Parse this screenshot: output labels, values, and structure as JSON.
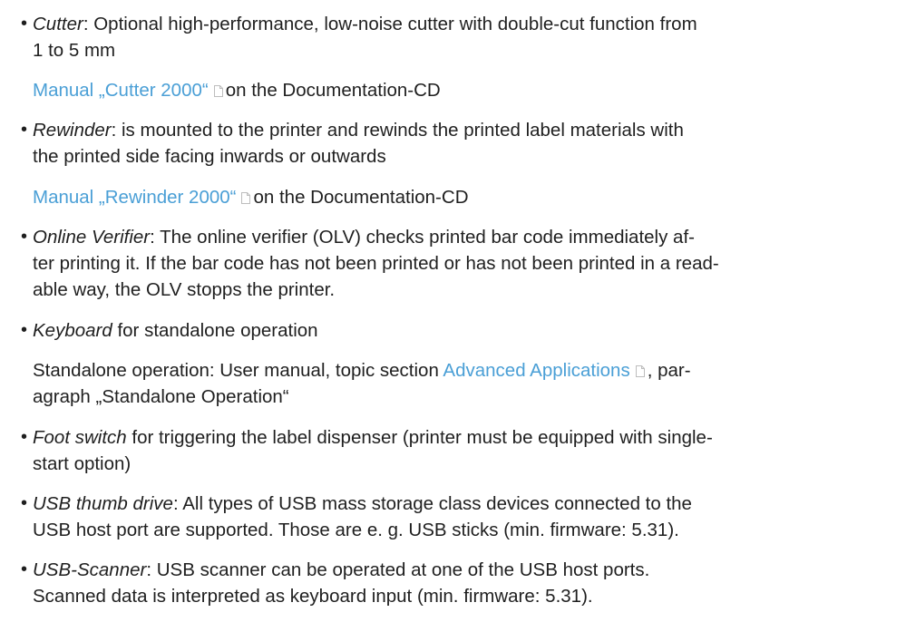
{
  "items": [
    {
      "term": "Cutter",
      "text_line1": ": Optional high-performance, low-noise cutter with double-cut function from",
      "text_line2": "1 to 5 mm",
      "sub_link": "Manual „Cutter 2000“",
      "sub_text": "on the Documentation-CD"
    },
    {
      "term": "Rewinder",
      "text_line1": ": is mounted to the printer and rewinds the printed label materials with",
      "text_line2": "the printed side facing inwards or outwards",
      "sub_link": "Manual „Rewinder 2000“",
      "sub_text": "on the Documentation-CD"
    },
    {
      "term": "Online Verifier",
      "text_line1": ": The online verifier (OLV) checks printed bar code immediately af-",
      "text_line2": "ter printing it. If the bar code has not been printed or has not been printed in a read-",
      "text_line3": "able way, the OLV stopps the printer."
    },
    {
      "term": "Keyboard",
      "text_line1": " for standalone operation",
      "sub_prefix": "Standalone operation: User manual, topic section ",
      "sub_link": "Advanced Applications",
      "sub_suffix": ", par-",
      "sub_line2": "agraph „Standalone Operation“"
    },
    {
      "term": "Foot switch",
      "text_line1": " for triggering the label dispenser (printer must be equipped with single-",
      "text_line2": "start option)"
    },
    {
      "term": "USB thumb drive",
      "text_line1": ": All types of USB mass storage class devices connected to the",
      "text_line2": "USB host port are supported. Those are e. g. USB sticks (min. firmware: 5.31)."
    },
    {
      "term": "USB-Scanner",
      "text_line1": ": USB scanner can be operated at one of the USB host ports.",
      "text_line2": "Scanned data is interpreted as keyboard input (min. firmware: 5.31)."
    }
  ],
  "bullet_char": "•",
  "icon": "document-icon"
}
